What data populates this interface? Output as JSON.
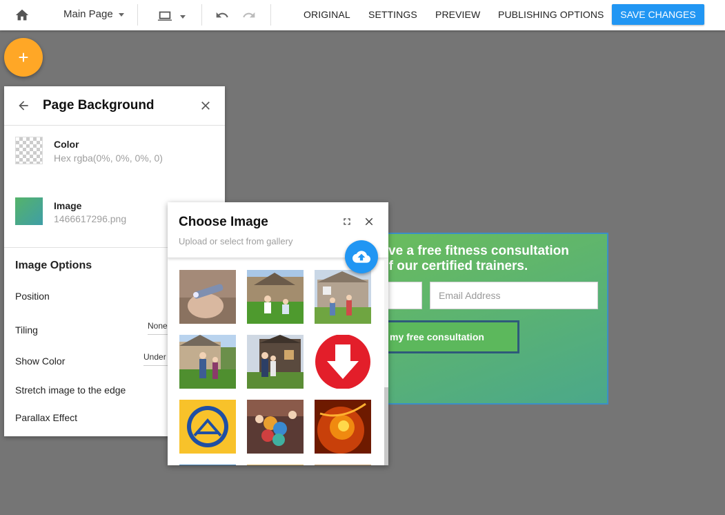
{
  "topbar": {
    "page_name": "Main Page",
    "nav": [
      "ORIGINAL",
      "SETTINGS",
      "PREVIEW",
      "PUBLISHING OPTIONS"
    ],
    "save_label": "SAVE CHANGES",
    "icons": [
      "home-icon",
      "laptop-icon",
      "undo-icon",
      "redo-icon"
    ]
  },
  "fab": {
    "label": "+"
  },
  "bg_panel": {
    "title": "Page Background",
    "color": {
      "label": "Color",
      "value": "Hex rgba(0%, 0%, 0%, 0)"
    },
    "image": {
      "label": "Image",
      "value": "1466617296.png"
    },
    "options_title": "Image Options",
    "options": {
      "position": "Position",
      "tiling": "Tiling",
      "tiling_value": "None",
      "show_color": "Show Color",
      "show_color_value": "Under",
      "stretch": "Stretch image to the edge",
      "parallax": "Parallax Effect"
    }
  },
  "image_panel": {
    "title": "Choose Image",
    "subtitle": "Upload or select from gallery",
    "icons": [
      "expand-icon",
      "close-icon",
      "cloud-upload-icon"
    ],
    "thumbnails": [
      "usb-hand",
      "family-lawn",
      "family-house",
      "family-yard",
      "couple-house",
      "download-arrow",
      "warriors-logo",
      "party-balloons",
      "sun-flare"
    ]
  },
  "preview": {
    "headline_line1": "ve a free fitness consultation",
    "headline_line2": "of our certified trainers.",
    "email_placeholder": "Email Address",
    "button_label": "my free consultation"
  },
  "colors": {
    "accent": "#2196f3",
    "fab": "#ffa726",
    "canvas": "#757575",
    "cta": "#5cb85c"
  }
}
